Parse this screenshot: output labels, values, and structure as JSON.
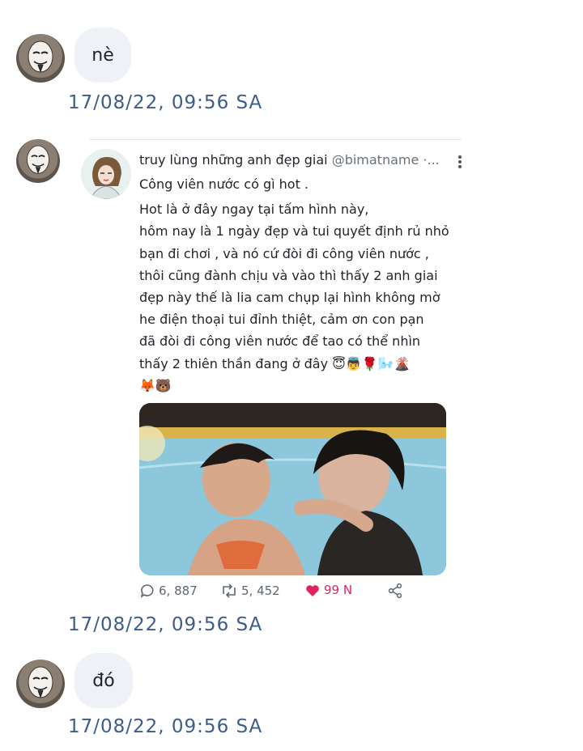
{
  "messages": [
    {
      "text": "nè",
      "timestamp": "17/08/22,  09:56 SA"
    },
    {
      "timestamp": "17/08/22,  09:56 SA"
    },
    {
      "text": "đó",
      "timestamp": "17/08/22,  09:56 SA"
    }
  ],
  "tweet": {
    "author_name": "truy lùng những anh đẹp giai",
    "handle": "@bimatname ·...",
    "lines": [
      "Công viên nước có gì hot .",
      "Hot là ở đây ngay tại tấm hình này,",
      "hôm nay là 1 ngày đẹp và tui quyết định rủ nhỏ",
      "bạn đi chơi ,  và nó cứ đòi đi công viên nước ,",
      "thôi cũng đành chịu và vào thì thấy 2 anh giai",
      "đẹp này thế là lia cam chụp lại hình không mờ",
      "he điện thoại tui đỉnh thiệt,  cảm ơn con pạn",
      "đã đòi đi công viên nước để tao có thể nhìn",
      "thấy 2 thiên thần đang ở đây 😇👼🌹🌬️🌋",
      "🦊🐻"
    ],
    "replies": "6, 887",
    "retweets": "5, 452",
    "likes": "99 N"
  },
  "colors": {
    "timestamp": "#3c5d89",
    "bubble": "#eef1f6",
    "like": "#e0245e"
  }
}
